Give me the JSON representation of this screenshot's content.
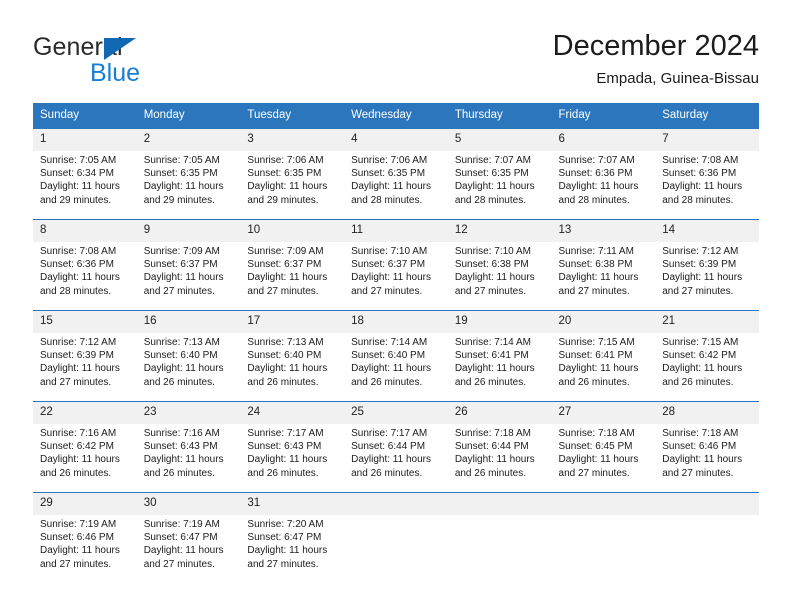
{
  "brand": {
    "name_part1": "General",
    "name_part2": "Blue",
    "triangle_color": "#1268b3",
    "blue_color": "#1a7fd4"
  },
  "header": {
    "title": "December 2024",
    "subtitle": "Empada, Guinea-Bissau"
  },
  "theme": {
    "header_bg": "#2b76bd",
    "daynum_bg": "#f1f1f1",
    "text": "#1c1c1c"
  },
  "calendar": {
    "weekday_headers": [
      "Sunday",
      "Monday",
      "Tuesday",
      "Wednesday",
      "Thursday",
      "Friday",
      "Saturday"
    ],
    "labels": {
      "sunrise": "Sunrise:",
      "sunset": "Sunset:",
      "daylight": "Daylight:"
    },
    "weeks": [
      [
        {
          "day": "1",
          "sunrise": "Sunrise: 7:05 AM",
          "sunset": "Sunset: 6:34 PM",
          "daylight": "Daylight: 11 hours and 29 minutes."
        },
        {
          "day": "2",
          "sunrise": "Sunrise: 7:05 AM",
          "sunset": "Sunset: 6:35 PM",
          "daylight": "Daylight: 11 hours and 29 minutes."
        },
        {
          "day": "3",
          "sunrise": "Sunrise: 7:06 AM",
          "sunset": "Sunset: 6:35 PM",
          "daylight": "Daylight: 11 hours and 29 minutes."
        },
        {
          "day": "4",
          "sunrise": "Sunrise: 7:06 AM",
          "sunset": "Sunset: 6:35 PM",
          "daylight": "Daylight: 11 hours and 28 minutes."
        },
        {
          "day": "5",
          "sunrise": "Sunrise: 7:07 AM",
          "sunset": "Sunset: 6:35 PM",
          "daylight": "Daylight: 11 hours and 28 minutes."
        },
        {
          "day": "6",
          "sunrise": "Sunrise: 7:07 AM",
          "sunset": "Sunset: 6:36 PM",
          "daylight": "Daylight: 11 hours and 28 minutes."
        },
        {
          "day": "7",
          "sunrise": "Sunrise: 7:08 AM",
          "sunset": "Sunset: 6:36 PM",
          "daylight": "Daylight: 11 hours and 28 minutes."
        }
      ],
      [
        {
          "day": "8",
          "sunrise": "Sunrise: 7:08 AM",
          "sunset": "Sunset: 6:36 PM",
          "daylight": "Daylight: 11 hours and 28 minutes."
        },
        {
          "day": "9",
          "sunrise": "Sunrise: 7:09 AM",
          "sunset": "Sunset: 6:37 PM",
          "daylight": "Daylight: 11 hours and 27 minutes."
        },
        {
          "day": "10",
          "sunrise": "Sunrise: 7:09 AM",
          "sunset": "Sunset: 6:37 PM",
          "daylight": "Daylight: 11 hours and 27 minutes."
        },
        {
          "day": "11",
          "sunrise": "Sunrise: 7:10 AM",
          "sunset": "Sunset: 6:37 PM",
          "daylight": "Daylight: 11 hours and 27 minutes."
        },
        {
          "day": "12",
          "sunrise": "Sunrise: 7:10 AM",
          "sunset": "Sunset: 6:38 PM",
          "daylight": "Daylight: 11 hours and 27 minutes."
        },
        {
          "day": "13",
          "sunrise": "Sunrise: 7:11 AM",
          "sunset": "Sunset: 6:38 PM",
          "daylight": "Daylight: 11 hours and 27 minutes."
        },
        {
          "day": "14",
          "sunrise": "Sunrise: 7:12 AM",
          "sunset": "Sunset: 6:39 PM",
          "daylight": "Daylight: 11 hours and 27 minutes."
        }
      ],
      [
        {
          "day": "15",
          "sunrise": "Sunrise: 7:12 AM",
          "sunset": "Sunset: 6:39 PM",
          "daylight": "Daylight: 11 hours and 27 minutes."
        },
        {
          "day": "16",
          "sunrise": "Sunrise: 7:13 AM",
          "sunset": "Sunset: 6:40 PM",
          "daylight": "Daylight: 11 hours and 26 minutes."
        },
        {
          "day": "17",
          "sunrise": "Sunrise: 7:13 AM",
          "sunset": "Sunset: 6:40 PM",
          "daylight": "Daylight: 11 hours and 26 minutes."
        },
        {
          "day": "18",
          "sunrise": "Sunrise: 7:14 AM",
          "sunset": "Sunset: 6:40 PM",
          "daylight": "Daylight: 11 hours and 26 minutes."
        },
        {
          "day": "19",
          "sunrise": "Sunrise: 7:14 AM",
          "sunset": "Sunset: 6:41 PM",
          "daylight": "Daylight: 11 hours and 26 minutes."
        },
        {
          "day": "20",
          "sunrise": "Sunrise: 7:15 AM",
          "sunset": "Sunset: 6:41 PM",
          "daylight": "Daylight: 11 hours and 26 minutes."
        },
        {
          "day": "21",
          "sunrise": "Sunrise: 7:15 AM",
          "sunset": "Sunset: 6:42 PM",
          "daylight": "Daylight: 11 hours and 26 minutes."
        }
      ],
      [
        {
          "day": "22",
          "sunrise": "Sunrise: 7:16 AM",
          "sunset": "Sunset: 6:42 PM",
          "daylight": "Daylight: 11 hours and 26 minutes."
        },
        {
          "day": "23",
          "sunrise": "Sunrise: 7:16 AM",
          "sunset": "Sunset: 6:43 PM",
          "daylight": "Daylight: 11 hours and 26 minutes."
        },
        {
          "day": "24",
          "sunrise": "Sunrise: 7:17 AM",
          "sunset": "Sunset: 6:43 PM",
          "daylight": "Daylight: 11 hours and 26 minutes."
        },
        {
          "day": "25",
          "sunrise": "Sunrise: 7:17 AM",
          "sunset": "Sunset: 6:44 PM",
          "daylight": "Daylight: 11 hours and 26 minutes."
        },
        {
          "day": "26",
          "sunrise": "Sunrise: 7:18 AM",
          "sunset": "Sunset: 6:44 PM",
          "daylight": "Daylight: 11 hours and 26 minutes."
        },
        {
          "day": "27",
          "sunrise": "Sunrise: 7:18 AM",
          "sunset": "Sunset: 6:45 PM",
          "daylight": "Daylight: 11 hours and 27 minutes."
        },
        {
          "day": "28",
          "sunrise": "Sunrise: 7:18 AM",
          "sunset": "Sunset: 6:46 PM",
          "daylight": "Daylight: 11 hours and 27 minutes."
        }
      ],
      [
        {
          "day": "29",
          "sunrise": "Sunrise: 7:19 AM",
          "sunset": "Sunset: 6:46 PM",
          "daylight": "Daylight: 11 hours and 27 minutes."
        },
        {
          "day": "30",
          "sunrise": "Sunrise: 7:19 AM",
          "sunset": "Sunset: 6:47 PM",
          "daylight": "Daylight: 11 hours and 27 minutes."
        },
        {
          "day": "31",
          "sunrise": "Sunrise: 7:20 AM",
          "sunset": "Sunset: 6:47 PM",
          "daylight": "Daylight: 11 hours and 27 minutes."
        },
        {
          "day": "",
          "sunrise": "",
          "sunset": "",
          "daylight": ""
        },
        {
          "day": "",
          "sunrise": "",
          "sunset": "",
          "daylight": ""
        },
        {
          "day": "",
          "sunrise": "",
          "sunset": "",
          "daylight": ""
        },
        {
          "day": "",
          "sunrise": "",
          "sunset": "",
          "daylight": ""
        }
      ]
    ]
  }
}
